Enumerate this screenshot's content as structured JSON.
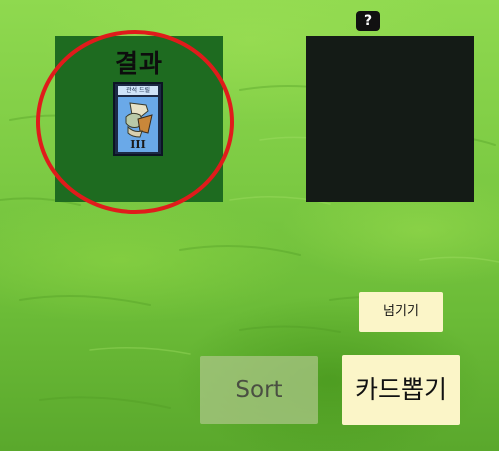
{
  "result_panel": {
    "title": "결과",
    "card": {
      "name": "관석 드릴",
      "grade": "III"
    }
  },
  "help_button": {
    "label": "?"
  },
  "buttons": {
    "skip_label": "넘기기",
    "sort_label": "Sort",
    "draw_label": "카드뽑기"
  },
  "colors": {
    "result_panel_bg": "#1e6b20",
    "mystery_panel_bg": "#141b16",
    "highlight_circle": "#e01b1b",
    "button_bg": "#fbf5c8"
  }
}
